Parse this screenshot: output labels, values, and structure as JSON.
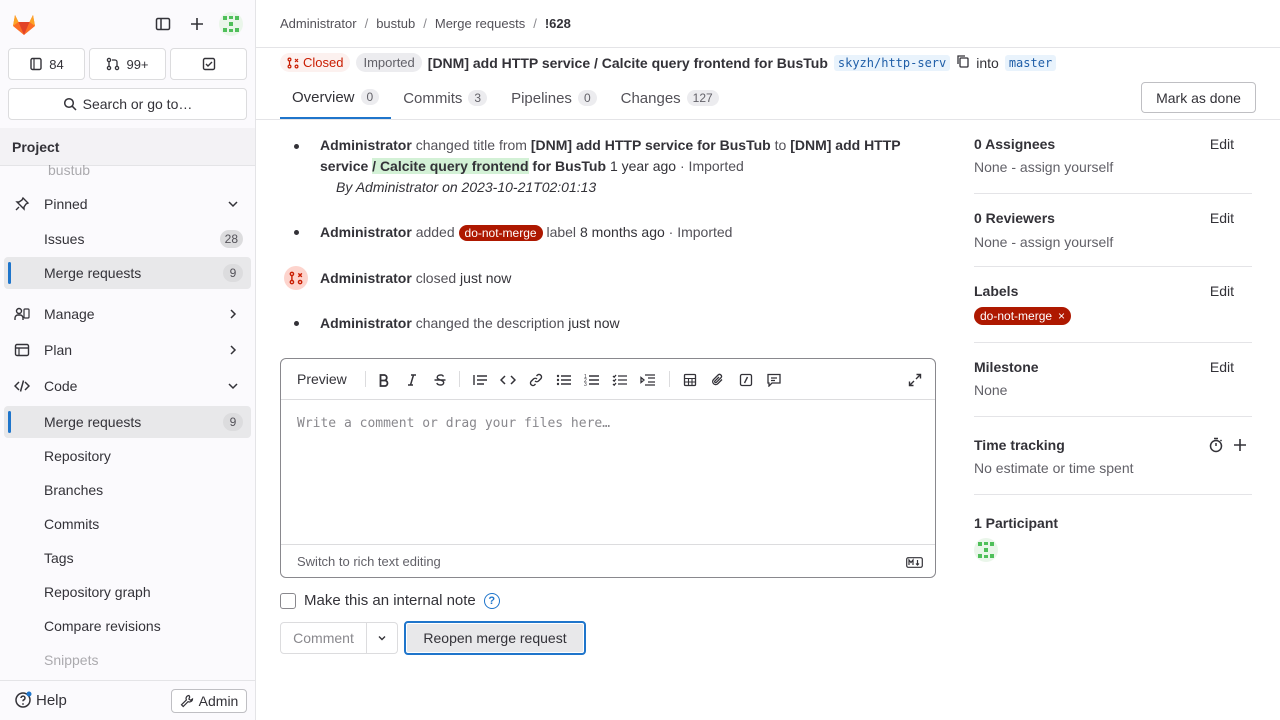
{
  "sidebar": {
    "counters": {
      "issues": "84",
      "merge_requests": "99+"
    },
    "search_label": "Search or go to…",
    "section_title": "Project",
    "faded_item": "bustub",
    "items": [
      {
        "label": "Pinned"
      },
      {
        "label": "Issues",
        "count": "28"
      },
      {
        "label": "Merge requests",
        "count": "9"
      },
      {
        "label": "Manage"
      },
      {
        "label": "Plan"
      },
      {
        "label": "Code"
      },
      {
        "label": "Merge requests",
        "count": "9"
      },
      {
        "label": "Repository"
      },
      {
        "label": "Branches"
      },
      {
        "label": "Commits"
      },
      {
        "label": "Tags"
      },
      {
        "label": "Repository graph"
      },
      {
        "label": "Compare revisions"
      },
      {
        "label": "Snippets"
      }
    ],
    "help_label": "Help",
    "admin_label": "Admin"
  },
  "breadcrumb": [
    "Administrator",
    "bustub",
    "Merge requests",
    "!628"
  ],
  "mr": {
    "status": "Closed",
    "imported": "Imported",
    "title": "[DNM] add HTTP service / Calcite query frontend for BusTub",
    "source_branch": "skyzh/http-serv",
    "into": "into",
    "target_branch": "master"
  },
  "tabs": [
    {
      "label": "Overview",
      "count": "0"
    },
    {
      "label": "Commits",
      "count": "3"
    },
    {
      "label": "Pipelines",
      "count": "0"
    },
    {
      "label": "Changes",
      "count": "127"
    }
  ],
  "mark_done": "Mark as done",
  "activity": {
    "n1": {
      "author": "Administrator",
      "action": "changed title from",
      "old_title": "[DNM] add HTTP service for BusTub",
      "to": "to",
      "new_a": "[DNM] add HTTP service",
      "new_hl": "/ Calcite query frontend",
      "new_b": "for BusTub",
      "time": "1 year ago",
      "imported": "· Imported",
      "by_line": "By Administrator on 2023-10-21T02:01:13"
    },
    "n2": {
      "author": "Administrator",
      "action": "added",
      "label": "do-not-merge",
      "suffix": "label",
      "time": "8 months ago",
      "imported": "· Imported"
    },
    "n3": {
      "author": "Administrator",
      "action": "closed",
      "time": "just now"
    },
    "n4": {
      "author": "Administrator",
      "action": "changed the description",
      "time": "just now"
    }
  },
  "editor": {
    "preview": "Preview",
    "placeholder": "Write a comment or drag your files here…",
    "switch": "Switch to rich text editing"
  },
  "internal_note": "Make this an internal note",
  "comment_label": "Comment",
  "reopen_label": "Reopen merge request",
  "right": {
    "assignees_title": "0 Assignees",
    "assignees_val": "None - assign yourself",
    "reviewers_title": "0 Reviewers",
    "reviewers_val": "None - assign yourself",
    "labels_title": "Labels",
    "label": "do-not-merge",
    "milestone_title": "Milestone",
    "milestone_val": "None",
    "time_title": "Time tracking",
    "time_val": "No estimate or time spent",
    "participants_title": "1 Participant",
    "edit": "Edit"
  },
  "colors": {
    "accent": "#1f75cb",
    "closed": "#c91c00",
    "label": "#ae1800"
  }
}
